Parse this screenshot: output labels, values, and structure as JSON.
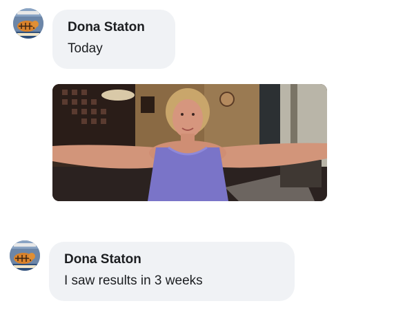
{
  "messages": [
    {
      "author": "Dona Staton",
      "text": "Today"
    },
    {
      "author": "Dona Staton",
      "text": "I saw results in 3 weeks"
    }
  ],
  "icons": {
    "avatar": "tiger-avatar-icon",
    "photo": "woman-arms-outstretched-photo"
  },
  "colors": {
    "bubble_background": "#f0f2f5",
    "text": "#1c1e21",
    "tank_top": "#7a74c8"
  }
}
